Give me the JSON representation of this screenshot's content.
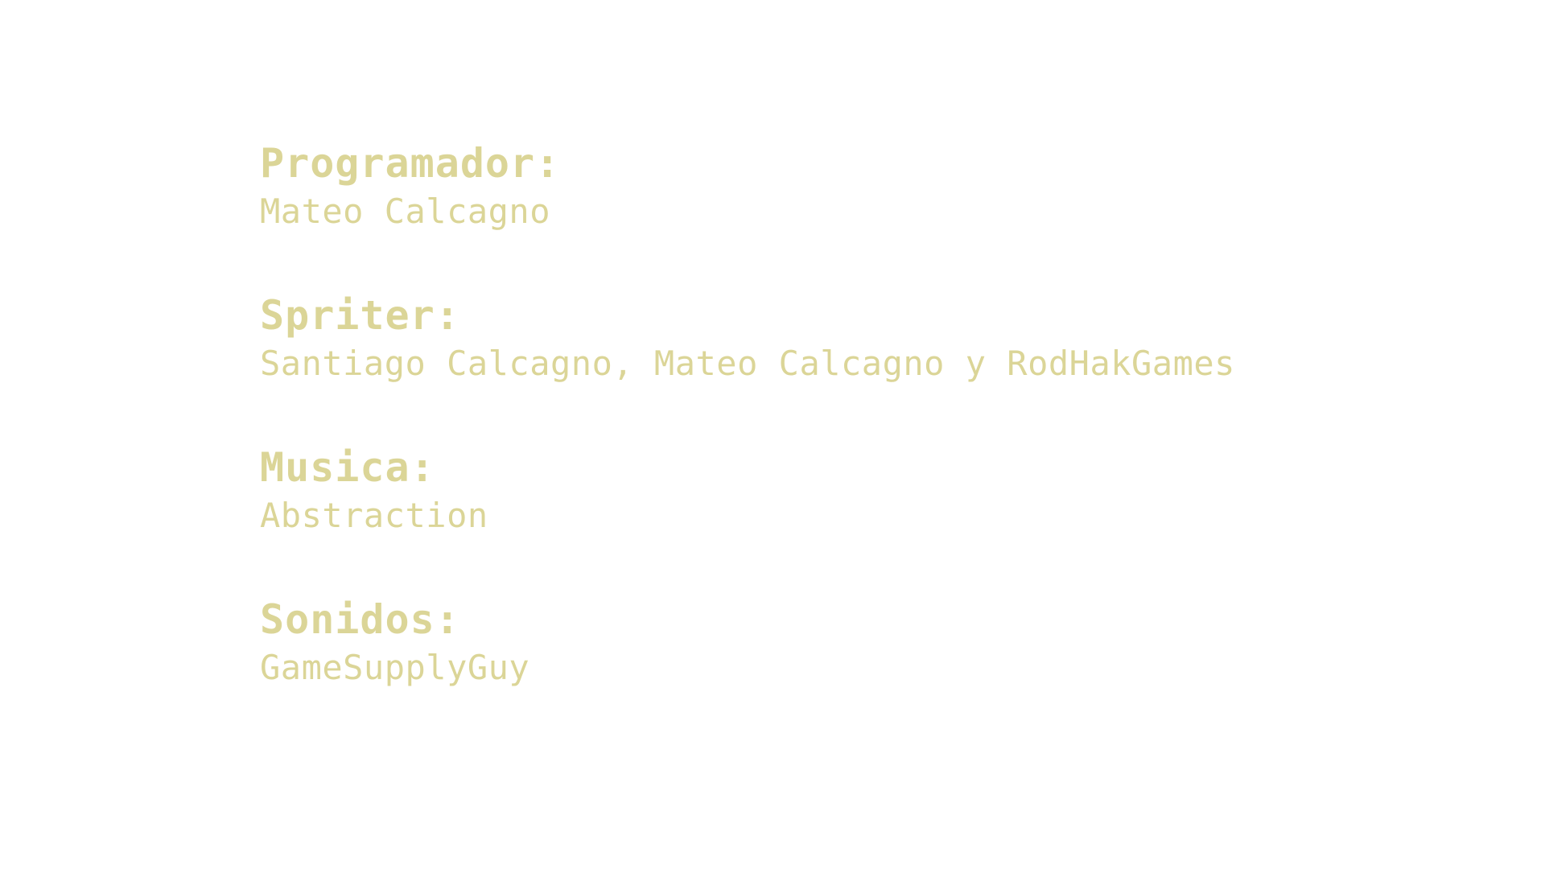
{
  "theme": {
    "text_color": "#dbd597",
    "background_color": "#ffffff"
  },
  "credits": [
    {
      "role": "Programador:",
      "names": "Mateo Calcagno"
    },
    {
      "role": "Spriter:",
      "names": "Santiago Calcagno, Mateo Calcagno y RodHakGames"
    },
    {
      "role": "Musica:",
      "names": "Abstraction"
    },
    {
      "role": "Sonidos:",
      "names": "GameSupplyGuy"
    }
  ]
}
